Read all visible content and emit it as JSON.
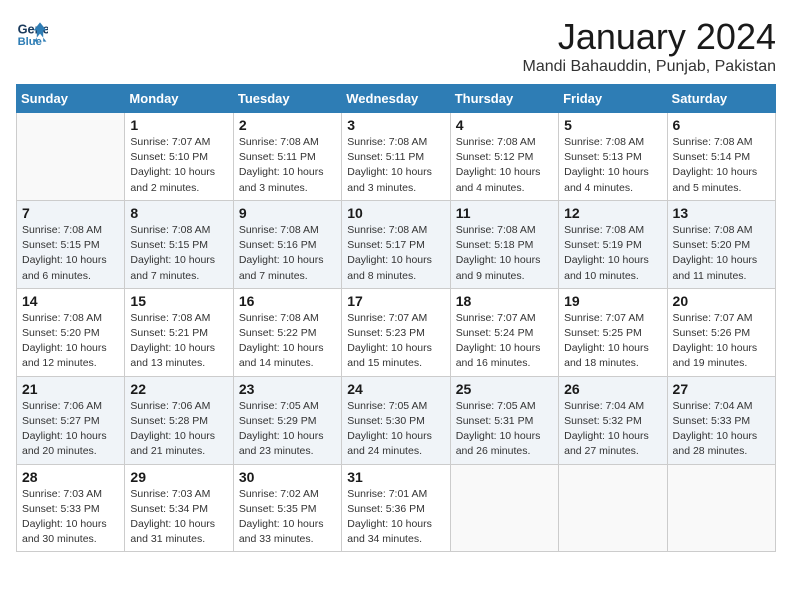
{
  "header": {
    "logo_line1": "General",
    "logo_line2": "Blue",
    "month": "January 2024",
    "location": "Mandi Bahauddin, Punjab, Pakistan"
  },
  "days_of_week": [
    "Sunday",
    "Monday",
    "Tuesday",
    "Wednesday",
    "Thursday",
    "Friday",
    "Saturday"
  ],
  "weeks": [
    [
      {
        "day": "",
        "info": ""
      },
      {
        "day": "1",
        "info": "Sunrise: 7:07 AM\nSunset: 5:10 PM\nDaylight: 10 hours\nand 2 minutes."
      },
      {
        "day": "2",
        "info": "Sunrise: 7:08 AM\nSunset: 5:11 PM\nDaylight: 10 hours\nand 3 minutes."
      },
      {
        "day": "3",
        "info": "Sunrise: 7:08 AM\nSunset: 5:11 PM\nDaylight: 10 hours\nand 3 minutes."
      },
      {
        "day": "4",
        "info": "Sunrise: 7:08 AM\nSunset: 5:12 PM\nDaylight: 10 hours\nand 4 minutes."
      },
      {
        "day": "5",
        "info": "Sunrise: 7:08 AM\nSunset: 5:13 PM\nDaylight: 10 hours\nand 4 minutes."
      },
      {
        "day": "6",
        "info": "Sunrise: 7:08 AM\nSunset: 5:14 PM\nDaylight: 10 hours\nand 5 minutes."
      }
    ],
    [
      {
        "day": "7",
        "info": "Sunrise: 7:08 AM\nSunset: 5:15 PM\nDaylight: 10 hours\nand 6 minutes."
      },
      {
        "day": "8",
        "info": "Sunrise: 7:08 AM\nSunset: 5:15 PM\nDaylight: 10 hours\nand 7 minutes."
      },
      {
        "day": "9",
        "info": "Sunrise: 7:08 AM\nSunset: 5:16 PM\nDaylight: 10 hours\nand 7 minutes."
      },
      {
        "day": "10",
        "info": "Sunrise: 7:08 AM\nSunset: 5:17 PM\nDaylight: 10 hours\nand 8 minutes."
      },
      {
        "day": "11",
        "info": "Sunrise: 7:08 AM\nSunset: 5:18 PM\nDaylight: 10 hours\nand 9 minutes."
      },
      {
        "day": "12",
        "info": "Sunrise: 7:08 AM\nSunset: 5:19 PM\nDaylight: 10 hours\nand 10 minutes."
      },
      {
        "day": "13",
        "info": "Sunrise: 7:08 AM\nSunset: 5:20 PM\nDaylight: 10 hours\nand 11 minutes."
      }
    ],
    [
      {
        "day": "14",
        "info": "Sunrise: 7:08 AM\nSunset: 5:20 PM\nDaylight: 10 hours\nand 12 minutes."
      },
      {
        "day": "15",
        "info": "Sunrise: 7:08 AM\nSunset: 5:21 PM\nDaylight: 10 hours\nand 13 minutes."
      },
      {
        "day": "16",
        "info": "Sunrise: 7:08 AM\nSunset: 5:22 PM\nDaylight: 10 hours\nand 14 minutes."
      },
      {
        "day": "17",
        "info": "Sunrise: 7:07 AM\nSunset: 5:23 PM\nDaylight: 10 hours\nand 15 minutes."
      },
      {
        "day": "18",
        "info": "Sunrise: 7:07 AM\nSunset: 5:24 PM\nDaylight: 10 hours\nand 16 minutes."
      },
      {
        "day": "19",
        "info": "Sunrise: 7:07 AM\nSunset: 5:25 PM\nDaylight: 10 hours\nand 18 minutes."
      },
      {
        "day": "20",
        "info": "Sunrise: 7:07 AM\nSunset: 5:26 PM\nDaylight: 10 hours\nand 19 minutes."
      }
    ],
    [
      {
        "day": "21",
        "info": "Sunrise: 7:06 AM\nSunset: 5:27 PM\nDaylight: 10 hours\nand 20 minutes."
      },
      {
        "day": "22",
        "info": "Sunrise: 7:06 AM\nSunset: 5:28 PM\nDaylight: 10 hours\nand 21 minutes."
      },
      {
        "day": "23",
        "info": "Sunrise: 7:05 AM\nSunset: 5:29 PM\nDaylight: 10 hours\nand 23 minutes."
      },
      {
        "day": "24",
        "info": "Sunrise: 7:05 AM\nSunset: 5:30 PM\nDaylight: 10 hours\nand 24 minutes."
      },
      {
        "day": "25",
        "info": "Sunrise: 7:05 AM\nSunset: 5:31 PM\nDaylight: 10 hours\nand 26 minutes."
      },
      {
        "day": "26",
        "info": "Sunrise: 7:04 AM\nSunset: 5:32 PM\nDaylight: 10 hours\nand 27 minutes."
      },
      {
        "day": "27",
        "info": "Sunrise: 7:04 AM\nSunset: 5:33 PM\nDaylight: 10 hours\nand 28 minutes."
      }
    ],
    [
      {
        "day": "28",
        "info": "Sunrise: 7:03 AM\nSunset: 5:33 PM\nDaylight: 10 hours\nand 30 minutes."
      },
      {
        "day": "29",
        "info": "Sunrise: 7:03 AM\nSunset: 5:34 PM\nDaylight: 10 hours\nand 31 minutes."
      },
      {
        "day": "30",
        "info": "Sunrise: 7:02 AM\nSunset: 5:35 PM\nDaylight: 10 hours\nand 33 minutes."
      },
      {
        "day": "31",
        "info": "Sunrise: 7:01 AM\nSunset: 5:36 PM\nDaylight: 10 hours\nand 34 minutes."
      },
      {
        "day": "",
        "info": ""
      },
      {
        "day": "",
        "info": ""
      },
      {
        "day": "",
        "info": ""
      }
    ]
  ]
}
